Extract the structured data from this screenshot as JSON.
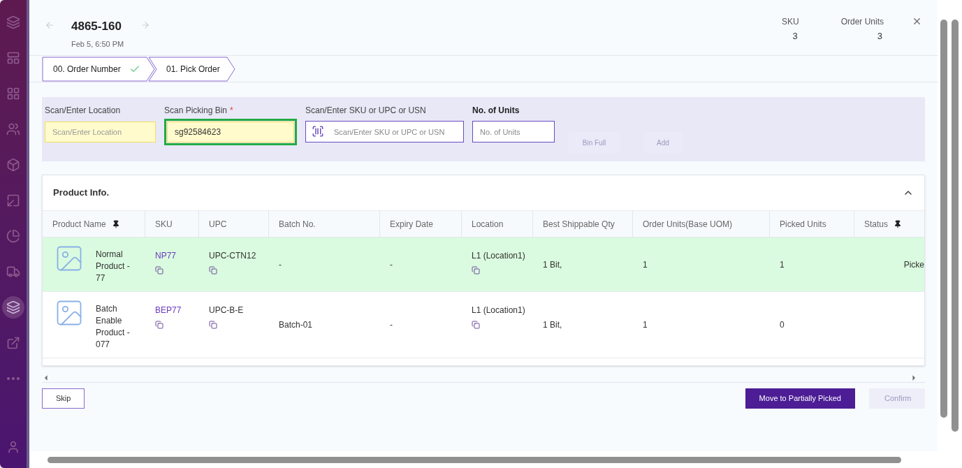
{
  "sidebar": {
    "items": [
      {
        "selected": false
      },
      {
        "selected": false
      },
      {
        "selected": false
      },
      {
        "selected": false
      },
      {
        "selected": false
      },
      {
        "selected": false
      },
      {
        "selected": false
      },
      {
        "selected": false
      },
      {
        "selected": true
      },
      {
        "selected": false
      },
      {
        "selected": false
      }
    ]
  },
  "header": {
    "title": "4865-160",
    "subtitle": "Feb 5, 6:50 PM",
    "stats": [
      {
        "label": "SKU",
        "value": "3"
      },
      {
        "label": "Order Units",
        "value": "3"
      }
    ]
  },
  "steps": [
    {
      "label": "00. Order Number",
      "done": true
    },
    {
      "label": "01. Pick Order",
      "done": false
    }
  ],
  "form": {
    "fields": [
      {
        "label": "Scan/Enter Location",
        "placeholder": "Scan/Enter Location",
        "kind": "highlight"
      },
      {
        "label": "Scan Picking Bin",
        "required_mark": "*",
        "value": "sg92584623",
        "kind": "focused"
      },
      {
        "label": "Scan/Enter SKU or UPC or USN",
        "placeholder": "Scan/Enter SKU or UPC or USN",
        "kind": "scan"
      },
      {
        "label": "No. of Units",
        "placeholder": "No. of Units",
        "kind": "units"
      }
    ],
    "buttons": [
      {
        "label": "Bin Full",
        "disabled": true
      },
      {
        "label": "Add",
        "disabled": true
      }
    ]
  },
  "panel": {
    "title": "Product Info.",
    "expanded": true,
    "columns": [
      {
        "label": "Product Name",
        "pinned": true
      },
      {
        "label": "SKU",
        "pinned": false
      },
      {
        "label": "UPC",
        "pinned": false
      },
      {
        "label": "Batch No.",
        "pinned": false
      },
      {
        "label": "Expiry Date",
        "pinned": false
      },
      {
        "label": "Location",
        "pinned": false
      },
      {
        "label": "Best Shippable Qty",
        "pinned": false
      },
      {
        "label": "Order Units(Base UOM)",
        "pinned": false
      },
      {
        "label": "Picked Units",
        "pinned": false
      },
      {
        "label": "Status",
        "pinned": true
      }
    ],
    "rows": [
      {
        "selected": true,
        "name": "Normal Product - 77",
        "sku": "NP77",
        "upc": "UPC-CTN12",
        "batch": "-",
        "expiry": "-",
        "location": "L1 (Location1)",
        "best_qty": "1 Bit,",
        "order_units": "1",
        "picked_units": "1",
        "status": "Picke"
      },
      {
        "selected": false,
        "name": "Batch Enable Product - 077",
        "sku": "BEP77",
        "upc": "UPC-B-E",
        "batch": "Batch-01",
        "expiry": "-",
        "location": "L1 (Location1)",
        "best_qty": "1 Bit,",
        "order_units": "1",
        "picked_units": "0"
      }
    ]
  },
  "footer": {
    "buttons": [
      {
        "label": "Skip",
        "kind": "outline"
      },
      {
        "label": "Move to Partially Picked",
        "kind": "primary"
      },
      {
        "label": "Confirm",
        "kind": "disabled"
      }
    ]
  }
}
